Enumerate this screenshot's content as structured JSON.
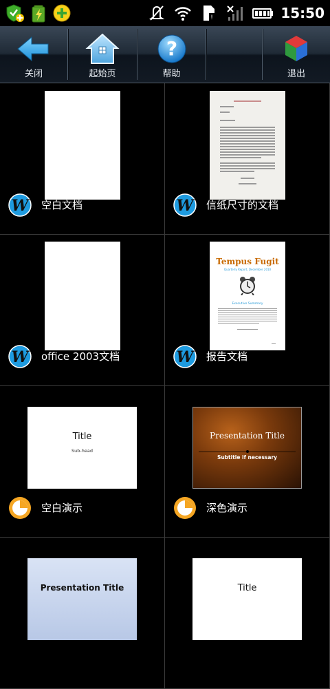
{
  "status_bar": {
    "time": "15:50",
    "icons": [
      "shield-add-icon",
      "battery-charging-app-icon",
      "plus-app-icon",
      "mute-icon",
      "wifi-icon",
      "sim-card-icon",
      "signal-icon",
      "battery-icon"
    ]
  },
  "toolbar": {
    "buttons": [
      {
        "label": "关闭",
        "icon": "back-arrow-icon"
      },
      {
        "label": "起始页",
        "icon": "home-icon"
      },
      {
        "label": "帮助",
        "icon": "help-icon"
      },
      {
        "label": "退出",
        "icon": "exit-cube-icon"
      }
    ]
  },
  "templates": [
    {
      "label": "空白文档",
      "type": "word",
      "thumb": "blank-page"
    },
    {
      "label": "信纸尺寸的文档",
      "type": "word",
      "thumb": "letter-page"
    },
    {
      "label": "office 2003文档",
      "type": "word",
      "thumb": "blank-page"
    },
    {
      "label": "报告文档",
      "type": "word",
      "thumb": "report-page",
      "thumb_text": {
        "title": "Tempus Fugit",
        "subtitle": "Quarterly Report, December 2010",
        "section": "Executive Summary"
      }
    },
    {
      "label": "空白演示",
      "type": "presentation",
      "thumb": "blank-slide",
      "thumb_text": {
        "title": "Title",
        "subtitle": "Sub-head"
      }
    },
    {
      "label": "深色演示",
      "type": "presentation",
      "thumb": "dark-slide",
      "thumb_text": {
        "title": "Presentation Title",
        "subtitle": "Subtitle if necessary"
      }
    },
    {
      "label": "",
      "type": "presentation",
      "thumb": "blue-slide",
      "thumb_text": {
        "title": "Presentation Title"
      }
    },
    {
      "label": "",
      "type": "presentation",
      "thumb": "white-slide",
      "thumb_text": {
        "title": "Title"
      }
    }
  ],
  "colors": {
    "word_icon": "#1e9be0",
    "presentation_icon": "#f5a623",
    "report_title": "#c86a00",
    "report_accent": "#2b9cd8"
  }
}
